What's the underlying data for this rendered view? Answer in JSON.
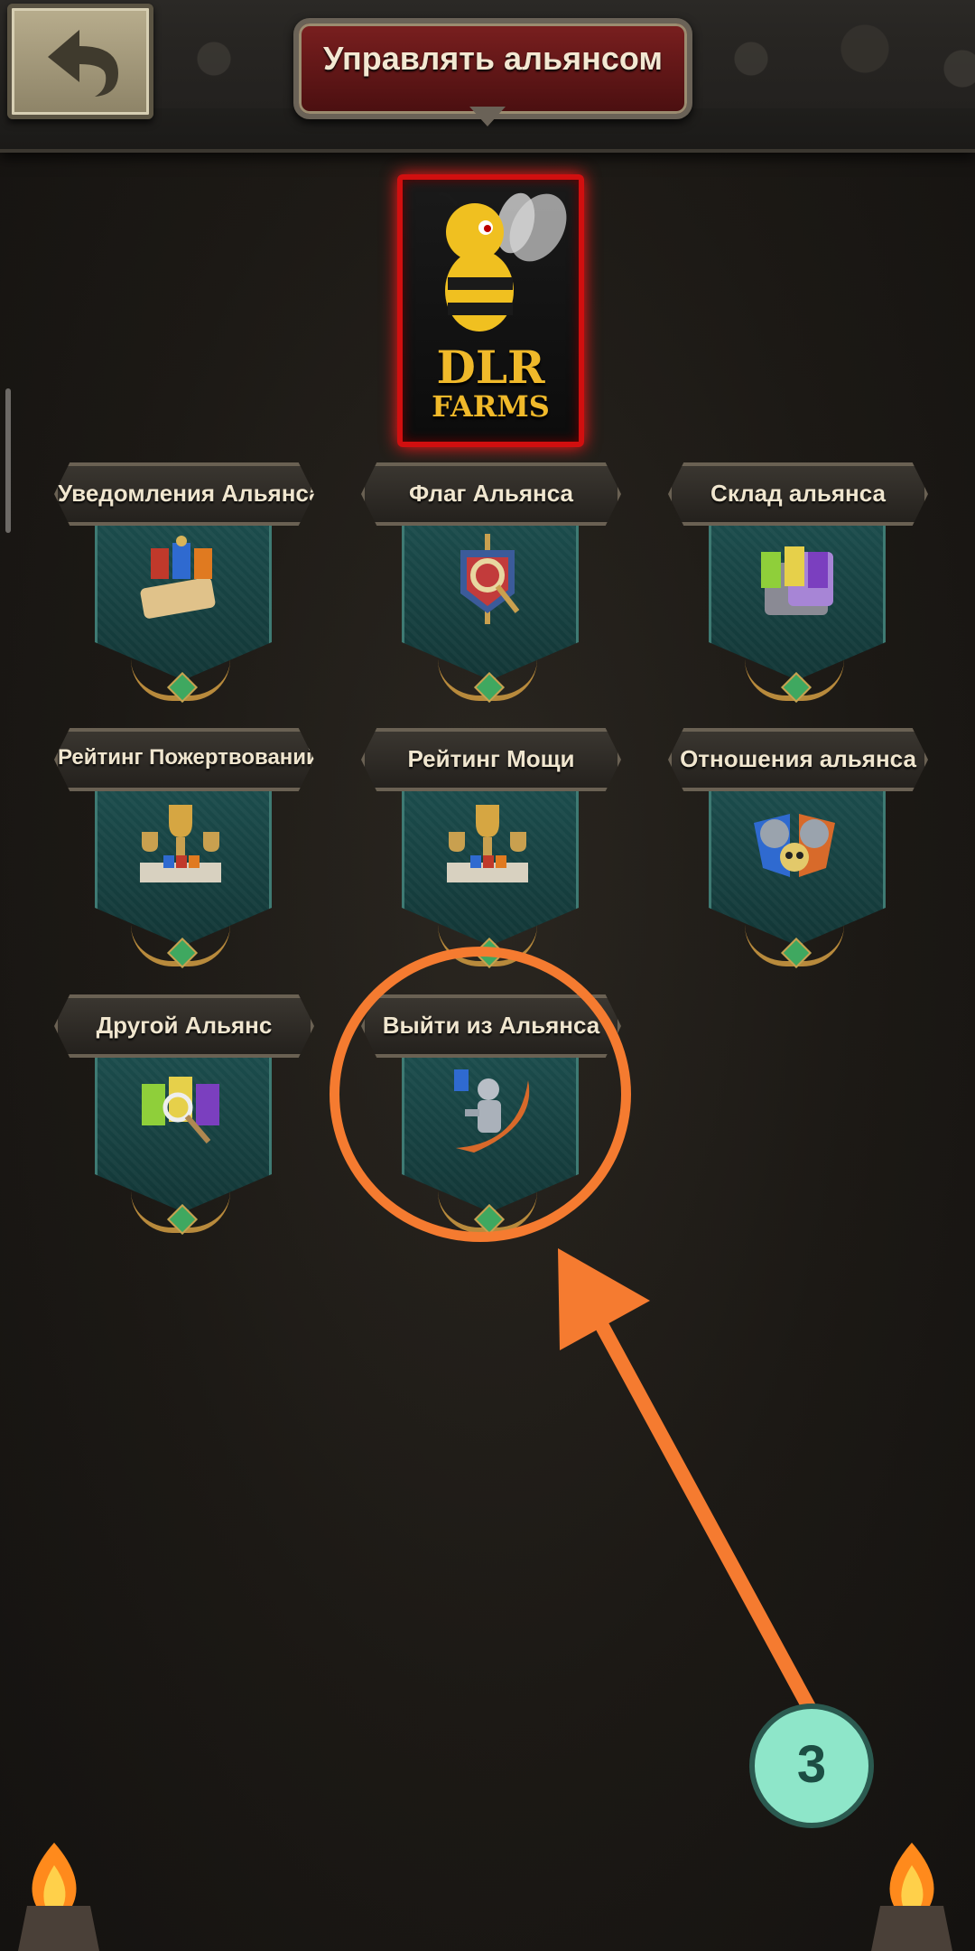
{
  "header": {
    "title": "Управлять альянсом",
    "back_icon": "undo-arrow-icon"
  },
  "emblem": {
    "line1": "DLR",
    "line2": "FARMS",
    "icon": "bee-mascot-icon"
  },
  "menu": [
    {
      "label": "Уведомления Альянса",
      "icon": "scroll-banners-icon"
    },
    {
      "label": "Флаг Альянса",
      "icon": "flag-shield-icon"
    },
    {
      "label": "Склад альянса",
      "icon": "treasure-chest-icon"
    },
    {
      "label": "Рейтинг Пожертвований",
      "icon": "trophy-podium-icon"
    },
    {
      "label": "Рейтинг Мощи",
      "icon": "trophy-podium-icon"
    },
    {
      "label": "Отношения альянса",
      "icon": "crossed-knights-icon"
    },
    {
      "label": "Другой Альянс",
      "icon": "banners-magnifier-icon"
    },
    {
      "label": "Выйти из Альянса",
      "icon": "departing-knight-icon"
    }
  ],
  "annotation": {
    "step_number": "3",
    "accent_color": "#f57b30",
    "badge_color": "#8ee6c9"
  }
}
